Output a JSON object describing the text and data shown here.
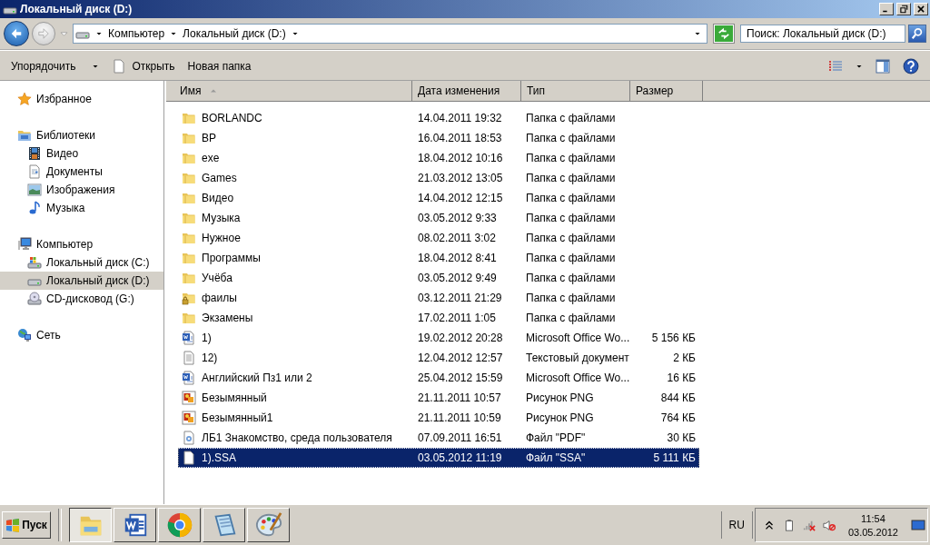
{
  "window": {
    "title": "Локальный диск (D:)"
  },
  "address_bar": {
    "breadcrumbs": [
      "Компьютер",
      "Локальный диск (D:)"
    ]
  },
  "search": {
    "placeholder": "Поиск: Локальный диск (D:)"
  },
  "toolbar": {
    "buttons": [
      {
        "label": "Упорядочить",
        "kind": "menu"
      },
      {
        "label": "Открыть",
        "kind": "open"
      },
      {
        "label": "Новая папка",
        "kind": "plain"
      }
    ]
  },
  "navigation": [
    {
      "label": "Избранное",
      "kind": "star",
      "selected": false
    },
    {
      "label": "Библиотеки",
      "kind": "library",
      "selected": false,
      "children": [
        {
          "label": "Видео",
          "kind": "video",
          "selected": false
        },
        {
          "label": "Документы",
          "kind": "documents",
          "selected": false
        },
        {
          "label": "Изображения",
          "kind": "images",
          "selected": false
        },
        {
          "label": "Музыка",
          "kind": "music",
          "selected": false
        }
      ]
    },
    {
      "label": "Компьютер",
      "kind": "computer",
      "selected": false,
      "children": [
        {
          "label": "Локальный диск (C:)",
          "kind": "system-drive",
          "selected": false
        },
        {
          "label": "Локальный диск (D:)",
          "kind": "drive",
          "selected": true
        },
        {
          "label": "CD-дисковод (G:)",
          "kind": "cd-drive",
          "selected": false
        }
      ]
    },
    {
      "label": "Сеть",
      "kind": "network",
      "selected": false
    }
  ],
  "file_list": {
    "columns": [
      {
        "label": "Имя",
        "sorted": true
      },
      {
        "label": "Дата изменения",
        "sorted": false
      },
      {
        "label": "Тип",
        "sorted": false
      },
      {
        "label": "Размер",
        "sorted": false
      }
    ],
    "rows": [
      {
        "name": "BORLANDC",
        "modified": "14.04.2011 19:32",
        "type": "Папка с файлами",
        "kind": "folder",
        "selected": false
      },
      {
        "name": "BP",
        "modified": "16.04.2011 18:53",
        "type": "Папка с файлами",
        "kind": "folder",
        "selected": false
      },
      {
        "name": "exe",
        "modified": "18.04.2012 10:16",
        "type": "Папка с файлами",
        "kind": "folder",
        "selected": false
      },
      {
        "name": "Games",
        "modified": "21.03.2012 13:05",
        "type": "Папка с файлами",
        "kind": "folder",
        "selected": false
      },
      {
        "name": "Видео",
        "modified": "14.04.2012 12:15",
        "type": "Папка с файлами",
        "kind": "folder",
        "selected": false
      },
      {
        "name": "Музыка",
        "modified": "03.05.2012 9:33",
        "type": "Папка с файлами",
        "kind": "folder",
        "selected": false
      },
      {
        "name": "Нужное",
        "modified": "08.02.2011 3:02",
        "type": "Папка с файлами",
        "kind": "folder",
        "selected": false
      },
      {
        "name": "Программы",
        "modified": "18.04.2012 8:41",
        "type": "Папка с файлами",
        "kind": "folder",
        "selected": false
      },
      {
        "name": "Учёба",
        "modified": "03.05.2012 9:49",
        "type": "Папка с файлами",
        "kind": "folder",
        "selected": false
      },
      {
        "name": "фаилы",
        "modified": "03.12.2011 21:29",
        "type": "Папка с файлами",
        "kind": "locked-folder",
        "selected": false
      },
      {
        "name": "Экзамены",
        "modified": "17.02.2011 1:05",
        "type": "Папка с файлами",
        "kind": "folder",
        "selected": false
      },
      {
        "name": "1)",
        "modified": "19.02.2012 20:28",
        "type": "Microsoft Office Wo...",
        "size": "5 156 КБ",
        "kind": "word",
        "selected": false
      },
      {
        "name": "12)",
        "modified": "12.04.2012 12:57",
        "type": "Текстовый документ",
        "size": "2 КБ",
        "kind": "text",
        "selected": false
      },
      {
        "name": "Английский Пз1 или 2",
        "modified": "25.04.2012 15:59",
        "type": "Microsoft Office Wo...",
        "size": "16 КБ",
        "kind": "word",
        "selected": false
      },
      {
        "name": "Безымянный",
        "modified": "21.11.2011 10:57",
        "type": "Рисунок PNG",
        "size": "844 КБ",
        "kind": "image",
        "selected": false
      },
      {
        "name": "Безымянный1",
        "modified": "21.11.2011 10:59",
        "type": "Рисунок PNG",
        "size": "764 КБ",
        "kind": "image",
        "selected": false
      },
      {
        "name": "ЛБ1  Знакомство, среда пользователя",
        "modified": "07.09.2011 16:51",
        "type": "Файл \"PDF\"",
        "size": "30 КБ",
        "kind": "pdf",
        "selected": false
      },
      {
        "name": "1).SSA",
        "modified": "03.05.2012 11:19",
        "type": "Файл \"SSA\"",
        "size": "5 111 КБ",
        "kind": "blank",
        "selected": true
      }
    ]
  },
  "taskbar": {
    "start": "Пуск",
    "apps": [
      {
        "kind": "explorer",
        "selected": true
      },
      {
        "kind": "word",
        "selected": false
      },
      {
        "kind": "browser",
        "selected": false
      },
      {
        "kind": "notepad",
        "selected": false
      },
      {
        "kind": "paint",
        "selected": false
      }
    ],
    "language": "RU",
    "time": "11:54",
    "date": "03.05.2012"
  }
}
